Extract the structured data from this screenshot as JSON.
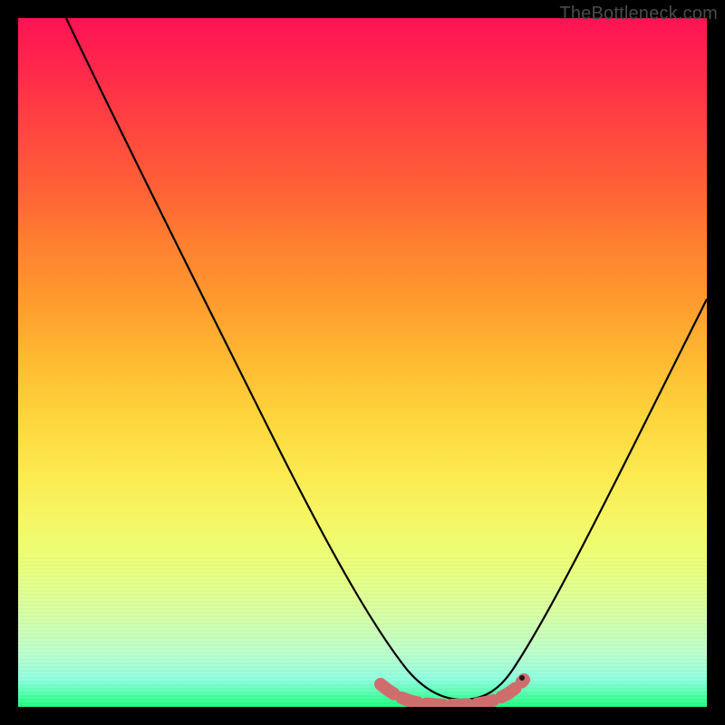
{
  "watermark": "TheBottleneck.com",
  "chart_data": {
    "type": "line",
    "title": "",
    "xlabel": "",
    "ylabel": "",
    "xlim": [
      0,
      100
    ],
    "ylim": [
      0,
      100
    ],
    "background_gradient": {
      "top": "#ff1255",
      "bottom": "#1dff7e",
      "stops": [
        "#ff1255",
        "#ff4540",
        "#ff8030",
        "#ffbb32",
        "#fce94f",
        "#e9ff7e",
        "#bdffcb",
        "#1dff7e"
      ]
    },
    "series": [
      {
        "name": "main-curve",
        "color": "#000000",
        "x": [
          7,
          15,
          25,
          35,
          45,
          52,
          58,
          63,
          68,
          72,
          78,
          85,
          92,
          100
        ],
        "y": [
          100,
          84,
          64,
          45,
          26,
          13,
          4,
          1,
          1,
          4,
          14,
          30,
          48,
          67
        ]
      },
      {
        "name": "bottom-highlight",
        "color": "#d46a6a",
        "x": [
          52,
          56,
          60,
          64,
          68,
          71,
          73
        ],
        "y": [
          5,
          2,
          1,
          1,
          1,
          3,
          6
        ]
      }
    ]
  }
}
